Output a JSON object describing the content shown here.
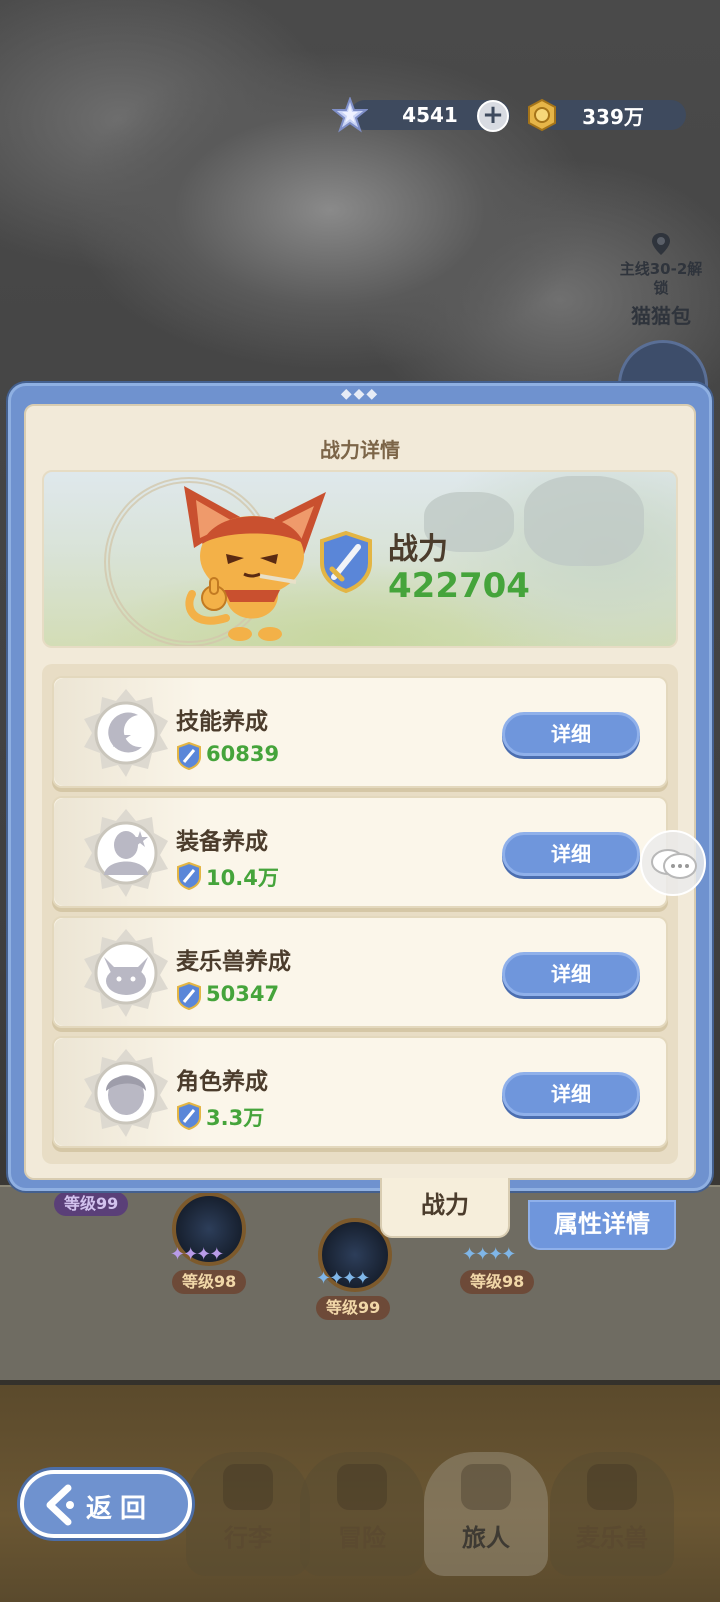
{
  "currency": {
    "gems": "4541",
    "gold": "339万",
    "gem_icon": "star-gem-icon",
    "gold_icon": "gold-coin-icon"
  },
  "side_unlock": {
    "condition": "主线30-2解锁",
    "name": "猫猫包"
  },
  "dialog": {
    "title": "战力详情",
    "power_label": "战力",
    "power_value": "422704"
  },
  "items": [
    {
      "name": "技能养成",
      "value": "60839",
      "button": "详细",
      "icon": "skill-icon"
    },
    {
      "name": "装备养成",
      "value": "10.4万",
      "button": "详细",
      "icon": "equipment-icon"
    },
    {
      "name": "麦乐兽养成",
      "value": "50347",
      "button": "详细",
      "icon": "pet-icon"
    },
    {
      "name": "角色养成",
      "value": "3.3万",
      "button": "详细",
      "icon": "character-icon"
    }
  ],
  "tabs": {
    "power": "战力",
    "attributes": "属性详情"
  },
  "party": {
    "levels": [
      "等级99",
      "等级98",
      "等级99",
      "等级98"
    ]
  },
  "nav": {
    "back": "返回",
    "items": [
      "行李",
      "冒险",
      "旅人",
      "麦乐兽"
    ],
    "active": "旅人"
  },
  "colors": {
    "power_green": "#45a43b",
    "button_blue": "#6f96dc",
    "dialog_frame": "#6f92cf",
    "panel_cream": "#f2ead9"
  }
}
